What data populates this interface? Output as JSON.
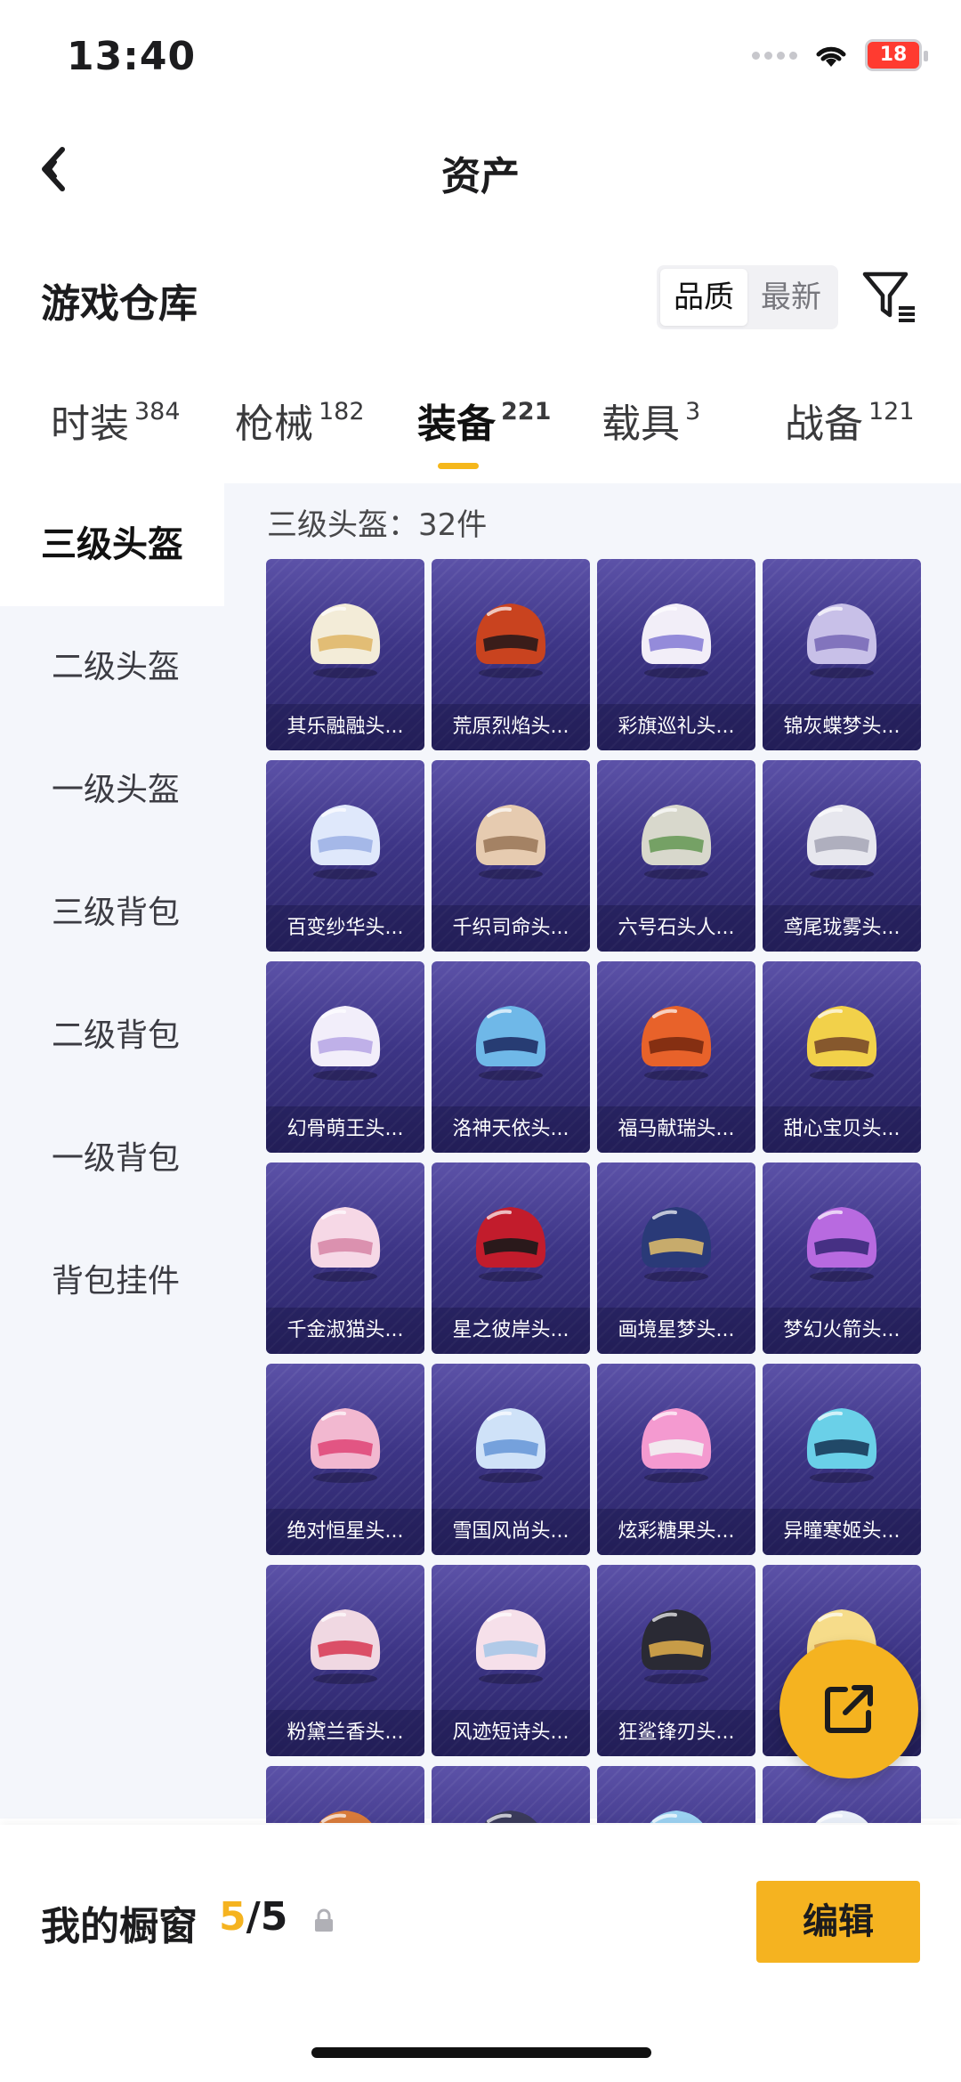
{
  "status_bar": {
    "time": "13:40",
    "battery": "18"
  },
  "nav": {
    "title": "资产"
  },
  "warehouse": {
    "title": "游戏仓库",
    "sort_options": [
      "品质",
      "最新"
    ],
    "active_sort": "品质"
  },
  "tabs": [
    {
      "label": "时装",
      "count": "384"
    },
    {
      "label": "枪械",
      "count": "182"
    },
    {
      "label": "装备",
      "count": "221",
      "active": true
    },
    {
      "label": "载具",
      "count": "3"
    },
    {
      "label": "战备",
      "count": "121"
    }
  ],
  "sidebar": {
    "items": [
      {
        "label": "三级头盔",
        "active": true
      },
      {
        "label": "二级头盔"
      },
      {
        "label": "一级头盔"
      },
      {
        "label": "三级背包"
      },
      {
        "label": "二级背包"
      },
      {
        "label": "一级背包"
      },
      {
        "label": "背包挂件"
      }
    ]
  },
  "content": {
    "count_label": "三级头盔：32件",
    "items": [
      {
        "name": "其乐融融头...",
        "color": "#f3ecd8",
        "accent": "#e0b86a"
      },
      {
        "name": "荒原烈焰头...",
        "color": "#c9431f",
        "accent": "#2a1a1a"
      },
      {
        "name": "彩旗巡礼头...",
        "color": "#f2eef8",
        "accent": "#8a7fd6"
      },
      {
        "name": "锦灰蝶梦头...",
        "color": "#c8c0e8",
        "accent": "#7a6bb8"
      },
      {
        "name": "百变纱华头...",
        "color": "#dfe8fb",
        "accent": "#9fb2e6"
      },
      {
        "name": "千织司命头...",
        "color": "#e6cbb0",
        "accent": "#9c7a5c"
      },
      {
        "name": "六号石头人...",
        "color": "#d8d8cc",
        "accent": "#6a9b5a"
      },
      {
        "name": "鸢尾珑雾头...",
        "color": "#e7e7ee",
        "accent": "#a8a8b8"
      },
      {
        "name": "幻骨萌王头...",
        "color": "#f2eefa",
        "accent": "#b9a8e6"
      },
      {
        "name": "洛神天依头...",
        "color": "#6fb8e8",
        "accent": "#1f2f66"
      },
      {
        "name": "福马献瑞头...",
        "color": "#e8622a",
        "accent": "#7a2a10"
      },
      {
        "name": "甜心宝贝头...",
        "color": "#f2d14a",
        "accent": "#7a4a2a"
      },
      {
        "name": "千金淑猫头...",
        "color": "#f6d8e6",
        "accent": "#d88aa8"
      },
      {
        "name": "星之彼岸头...",
        "color": "#c21c2c",
        "accent": "#1a1a1a"
      },
      {
        "name": "画境星梦头...",
        "color": "#2a3a78",
        "accent": "#d8b86a"
      },
      {
        "name": "梦幻火箭头...",
        "color": "#b86ae0",
        "accent": "#3a2a7a"
      },
      {
        "name": "绝对恒星头...",
        "color": "#f2b8d0",
        "accent": "#e04a7a"
      },
      {
        "name": "雪国风尚头...",
        "color": "#cfe2f8",
        "accent": "#6a9ad8"
      },
      {
        "name": "炫彩糖果头...",
        "color": "#f49ad0",
        "accent": "#f2f2f2"
      },
      {
        "name": "异瞳寒姬头...",
        "color": "#6ad0e8",
        "accent": "#1a3a5a"
      },
      {
        "name": "粉黛兰香头...",
        "color": "#f0d8e2",
        "accent": "#d8405a"
      },
      {
        "name": "风迹短诗头...",
        "color": "#f6e0ea",
        "accent": "#aac8e8"
      },
      {
        "name": "狂鲨锋刃头...",
        "color": "#2a2a34",
        "accent": "#d8a84a"
      },
      {
        "name": "",
        "color": "#f6dc8a",
        "accent": "#d8a04a"
      },
      {
        "name": "",
        "color": "#d87a3a",
        "accent": "#3a6a2a"
      },
      {
        "name": "",
        "color": "#3a3a5a",
        "accent": "#8a8ab8"
      },
      {
        "name": "",
        "color": "#9ad0f0",
        "accent": "#f2c04a"
      },
      {
        "name": "",
        "color": "#e8eef8",
        "accent": "#6aa8d8"
      }
    ]
  },
  "showcase": {
    "label": "我的橱窗",
    "current": "5",
    "total": "/5"
  },
  "edit_button": "编辑"
}
